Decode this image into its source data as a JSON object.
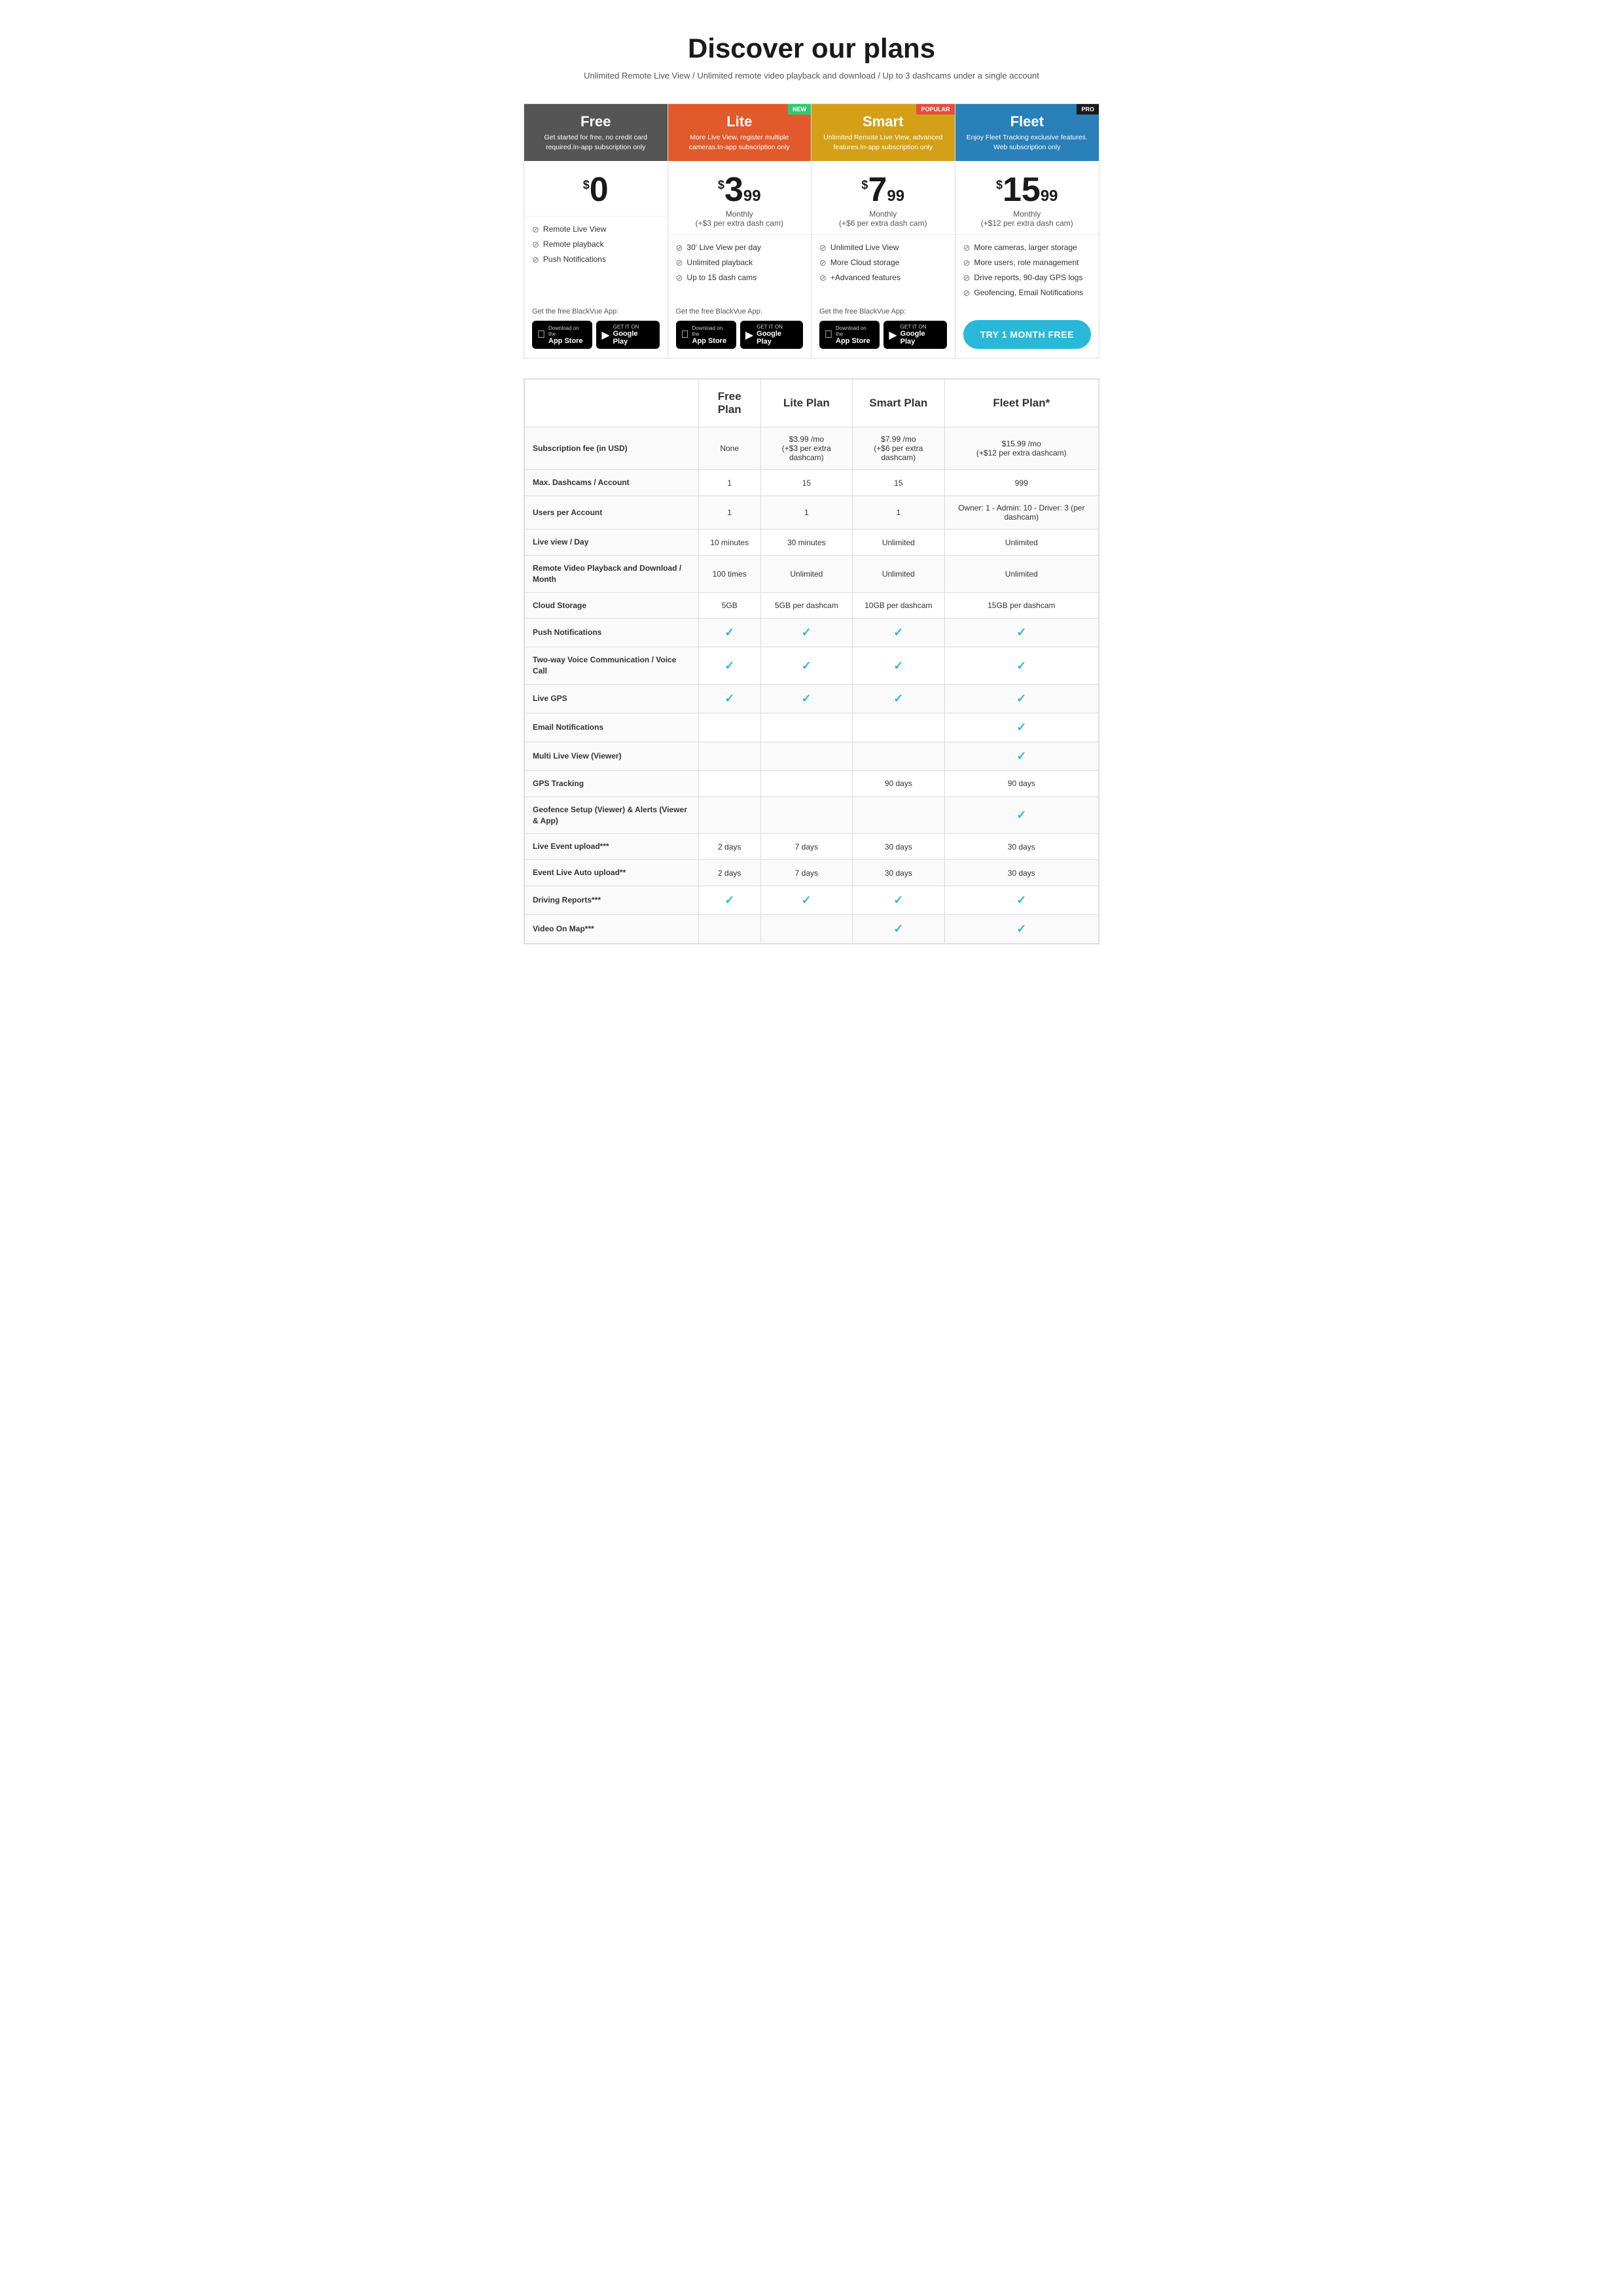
{
  "header": {
    "title": "Discover our plans",
    "subtitle": "Unlimited Remote Live View / Unlimited remote video playback and download / Up to 3 dashcams under a single account"
  },
  "plans": [
    {
      "id": "free",
      "name": "Free",
      "theme": "free",
      "badge": null,
      "desc": "Get started for free, no credit card required.In-app subscription only",
      "price_whole": "0",
      "price_decimal": "",
      "price_period": "",
      "features": [
        "Remote Live View",
        "Remote playback",
        "Push Notifications"
      ],
      "get_app_label": "Get the free BlackVue App:",
      "show_app_buttons": true,
      "show_try_btn": false,
      "try_btn_label": ""
    },
    {
      "id": "lite",
      "name": "Lite",
      "theme": "lite",
      "badge": "NEW",
      "badge_class": "badge-new",
      "desc": "More Live View, register multiple cameras.In-app subscription only",
      "price_whole": "3",
      "price_decimal": "99",
      "price_period": "Monthly\n(+$3 per extra dash cam)",
      "features": [
        "30' Live View per day",
        "Unlimited playback",
        "Up to 15 dash cams"
      ],
      "get_app_label": "Get the free BlackVue App:",
      "show_app_buttons": true,
      "show_try_btn": false,
      "try_btn_label": ""
    },
    {
      "id": "smart",
      "name": "Smart",
      "theme": "smart",
      "badge": "POPULAR",
      "badge_class": "badge-popular",
      "desc": "Unlimited Remote Live View, advanced features.In-app subscription only",
      "price_whole": "7",
      "price_decimal": "99",
      "price_period": "Monthly\n(+$6 per extra dash cam)",
      "features": [
        "Unlimited Live View",
        "More Cloud storage",
        "+Advanced features"
      ],
      "get_app_label": "Get the free BlackVue App:",
      "show_app_buttons": true,
      "show_try_btn": false,
      "try_btn_label": ""
    },
    {
      "id": "fleet",
      "name": "Fleet",
      "theme": "fleet",
      "badge": "PRO",
      "badge_class": "badge-pro",
      "desc": "Enjoy Fleet Tracking exclusive features. Web subscription only",
      "price_whole": "15",
      "price_decimal": "99",
      "price_period": "Monthly\n(+$12 per extra dash cam)",
      "features": [
        "More cameras, larger storage",
        "More users, role management",
        "Drive reports, 90-day GPS logs",
        "Geofencing, Email Notifications"
      ],
      "get_app_label": "",
      "show_app_buttons": false,
      "show_try_btn": true,
      "try_btn_label": "TRY 1 MONTH FREE"
    }
  ],
  "app_store": {
    "apple_sub": "Download on the",
    "apple_main": "App Store",
    "google_sub": "GET IT ON",
    "google_main": "Google Play"
  },
  "comparison": {
    "headers": [
      "",
      "Free Plan",
      "Lite Plan",
      "Smart Plan",
      "Fleet Plan*"
    ],
    "rows": [
      {
        "feature": "Subscription fee (in USD)",
        "free": "None",
        "lite": "$3.99 /mo\n(+$3 per extra dashcam)",
        "smart": "$7.99 /mo\n(+$6 per extra dashcam)",
        "fleet": "$15.99 /mo\n(+$12 per extra dashcam)"
      },
      {
        "feature": "Max. Dashcams / Account",
        "free": "1",
        "lite": "15",
        "smart": "15",
        "fleet": "999"
      },
      {
        "feature": "Users per Account",
        "free": "1",
        "lite": "1",
        "smart": "1",
        "fleet": "Owner: 1 - Admin: 10 - Driver: 3 (per dashcam)"
      },
      {
        "feature": "Live view / Day",
        "free": "10 minutes",
        "lite": "30 minutes",
        "smart": "Unlimited",
        "fleet": "Unlimited"
      },
      {
        "feature": "Remote Video Playback and Download / Month",
        "free": "100 times",
        "lite": "Unlimited",
        "smart": "Unlimited",
        "fleet": "Unlimited"
      },
      {
        "feature": "Cloud Storage",
        "free": "5GB",
        "lite": "5GB per dashcam",
        "smart": "10GB per dashcam",
        "fleet": "15GB per dashcam"
      },
      {
        "feature": "Push Notifications",
        "free": "check",
        "lite": "check",
        "smart": "check",
        "fleet": "check"
      },
      {
        "feature": "Two-way Voice Communication / Voice Call",
        "free": "check",
        "lite": "check",
        "smart": "check",
        "fleet": "check"
      },
      {
        "feature": "Live GPS",
        "free": "check",
        "lite": "check",
        "smart": "check",
        "fleet": "check"
      },
      {
        "feature": "Email Notifications",
        "free": "",
        "lite": "",
        "smart": "",
        "fleet": "check"
      },
      {
        "feature": "Multi Live View (Viewer)",
        "free": "",
        "lite": "",
        "smart": "",
        "fleet": "check"
      },
      {
        "feature": "GPS Tracking",
        "free": "",
        "lite": "",
        "smart": "90 days",
        "fleet": "90 days"
      },
      {
        "feature": "Geofence Setup (Viewer) & Alerts (Viewer & App)",
        "free": "",
        "lite": "",
        "smart": "",
        "fleet": "check"
      },
      {
        "feature": "Live Event upload***",
        "free": "2 days",
        "lite": "7 days",
        "smart": "30 days",
        "fleet": "30 days"
      },
      {
        "feature": "Event Live Auto upload**",
        "free": "2 days",
        "lite": "7 days",
        "smart": "30 days",
        "fleet": "30 days"
      },
      {
        "feature": "Driving Reports***",
        "free": "check",
        "lite": "check",
        "smart": "check",
        "fleet": "check"
      },
      {
        "feature": "Video On Map***",
        "free": "",
        "lite": "",
        "smart": "check",
        "fleet": "check"
      }
    ]
  }
}
